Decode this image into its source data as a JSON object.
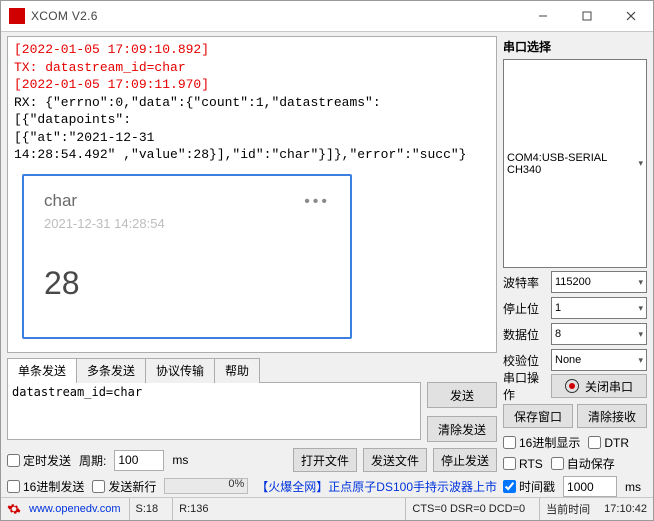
{
  "window": {
    "title": "XCOM V2.6"
  },
  "terminal": {
    "line1": "[2022-01-05 17:09:10.892]",
    "line2": "TX: datastream_id=char",
    "line3": "[2022-01-05 17:09:11.970]",
    "line4": "RX: {\"errno\":0,\"data\":{\"count\":1,\"datastreams\":[{\"datapoints\":",
    "line5": "[{\"at\":\"2021-12-31",
    "line6": "14:28:54.492\"  ,\"value\":28}],\"id\":\"char\"}]},\"error\":\"succ\"}",
    "card": {
      "title": "char",
      "timestamp": "2021-12-31 14:28:54",
      "value": "28",
      "menu": "•••"
    }
  },
  "tabs": {
    "t0": "单条发送",
    "t1": "多条发送",
    "t2": "协议传输",
    "t3": "帮助"
  },
  "send": {
    "text": "datastream_id=char",
    "send_btn": "发送",
    "clear_btn": "清除发送"
  },
  "opts": {
    "timed_send": "定时发送",
    "period_label": "周期:",
    "period_value": "100",
    "period_unit": "ms",
    "hex_send": "16进制发送",
    "send_newline": "发送新行",
    "open_file": "打开文件",
    "send_file": "发送文件",
    "stop_send": "停止发送",
    "progress": "0%",
    "ad": "【火爆全网】正点原子DS100手持示波器上市"
  },
  "right": {
    "section1": "串口选择",
    "port": "COM4:USB-SERIAL CH340",
    "baud_label": "波特率",
    "baud": "115200",
    "stop_label": "停止位",
    "stop": "1",
    "data_label": "数据位",
    "data": "8",
    "parity_label": "校验位",
    "parity": "None",
    "op_label": "串口操作",
    "op_btn": "关闭串口",
    "save_win": "保存窗口",
    "clear_recv": "清除接收",
    "hex_disp": "16进制显示",
    "dtr": "DTR",
    "rts": "RTS",
    "autosave": "自动保存",
    "timestamp": "时间戳",
    "ms_value": "1000",
    "ms_unit": "ms"
  },
  "status": {
    "url": "www.openedv.com",
    "s": "S:18",
    "r": "R:136",
    "signals": "CTS=0 DSR=0 DCD=0",
    "time_label": "当前时间",
    "time": "17:10:42"
  }
}
